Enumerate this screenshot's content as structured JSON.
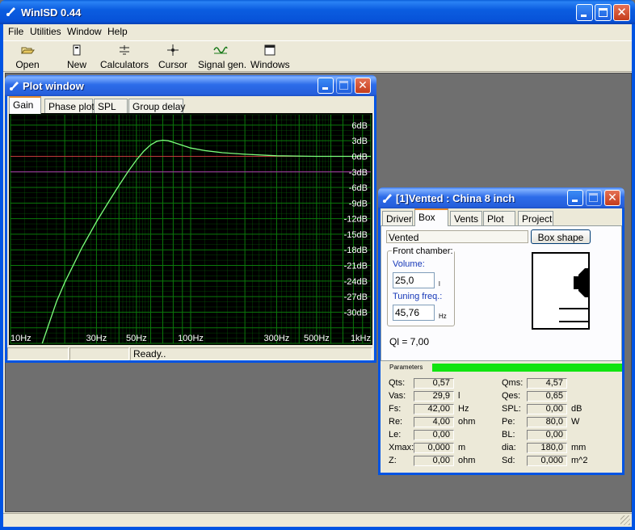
{
  "app": {
    "title": "WinISD 0.44"
  },
  "menu": [
    "File",
    "Utilities",
    "Window",
    "Help"
  ],
  "toolbar": [
    {
      "label": "Open",
      "icon": "folder-open-icon"
    },
    {
      "label": "New",
      "icon": "new-document-icon"
    },
    {
      "label": "Calculators",
      "icon": "calculator-icon"
    },
    {
      "label": "Cursor",
      "icon": "crosshair-icon"
    },
    {
      "label": "Signal gen.",
      "icon": "sine-wave-icon"
    },
    {
      "label": "Windows",
      "icon": "window-icon"
    }
  ],
  "plot_window": {
    "title": "Plot window",
    "tabs": [
      "Gain",
      "Phase plot",
      "SPL",
      "Group delay"
    ],
    "active_tab": "Gain",
    "status": [
      "",
      "",
      "Ready.."
    ],
    "colors": {
      "background": "#000000",
      "grid": "#0b7a0b",
      "curve": "#7cff7c",
      "zero_line": "#c03a3a",
      "ref_line": "#b030b0"
    }
  },
  "chart_data": {
    "type": "line",
    "xscale": "log",
    "xlim": [
      10,
      1000
    ],
    "ylim": [
      -36,
      8
    ],
    "x_ticks": [
      "10Hz",
      "30Hz",
      "50Hz",
      "100Hz",
      "300Hz",
      "500Hz",
      "1kHz"
    ],
    "x_tick_values": [
      10,
      30,
      50,
      100,
      300,
      500,
      1000
    ],
    "y_ticks": [
      "6dB",
      "3dB",
      "0dB",
      "-3dB",
      "-6dB",
      "-9dB",
      "-12dB",
      "-15dB",
      "-18dB",
      "-21dB",
      "-24dB",
      "-27dB",
      "-30dB"
    ],
    "y_tick_values": [
      6,
      3,
      0,
      -3,
      -6,
      -9,
      -12,
      -15,
      -18,
      -21,
      -24,
      -27,
      -30
    ],
    "grid": true,
    "series": [
      {
        "x": [
          15,
          18,
          20,
          25,
          30,
          35,
          40,
          45,
          50,
          55,
          60,
          65,
          70,
          75,
          80,
          90,
          100,
          120,
          150,
          200,
          300,
          500,
          1000
        ],
        "y": [
          -36,
          -28,
          -24.3,
          -17.5,
          -12.6,
          -8.8,
          -5.6,
          -2.9,
          -0.7,
          1.0,
          2.2,
          2.9,
          3.1,
          3.0,
          2.7,
          2.1,
          1.6,
          1.1,
          0.7,
          0.4,
          0.1,
          0,
          0
        ]
      }
    ],
    "reference_lines": [
      0,
      -3
    ]
  },
  "box_window": {
    "title": "[1]Vented : China 8 inch",
    "tabs": [
      "Driver",
      "Box",
      "Vents",
      "Plot",
      "Project"
    ],
    "active_tab": "Box",
    "box_type": "Vented",
    "box_shape_button": "Box shape",
    "front_chamber_label": "Front chamber:",
    "volume_label": "Volume:",
    "volume_value": "25,0",
    "volume_unit": "l",
    "tuning_label": "Tuning freq.:",
    "tuning_value": "45,76",
    "tuning_unit": "Hz",
    "ql": "Ql = 7,00",
    "parameters_label": "Parameters",
    "parameters_progress": 1.0,
    "params_left": [
      {
        "label": "Qts:",
        "value": "0,57",
        "unit": ""
      },
      {
        "label": "Vas:",
        "value": "29,9",
        "unit": "l"
      },
      {
        "label": "Fs:",
        "value": "42,00",
        "unit": "Hz"
      },
      {
        "label": "Re:",
        "value": "4,00",
        "unit": "ohm"
      },
      {
        "label": "Le:",
        "value": "0,00",
        "unit": ""
      },
      {
        "label": "Xmax:",
        "value": "0,000",
        "unit": "m"
      },
      {
        "label": "Z:",
        "value": "0,00",
        "unit": "ohm"
      }
    ],
    "params_right": [
      {
        "label": "Qms:",
        "value": "4,57",
        "unit": ""
      },
      {
        "label": "Qes:",
        "value": "0,65",
        "unit": ""
      },
      {
        "label": "SPL:",
        "value": "0,00",
        "unit": "dB"
      },
      {
        "label": "Pe:",
        "value": "80,0",
        "unit": "W"
      },
      {
        "label": "BL:",
        "value": "0,00",
        "unit": ""
      },
      {
        "label": "dia:",
        "value": "180,0",
        "unit": "mm"
      },
      {
        "label": "Sd:",
        "value": "0,000",
        "unit": "m^2"
      }
    ]
  }
}
